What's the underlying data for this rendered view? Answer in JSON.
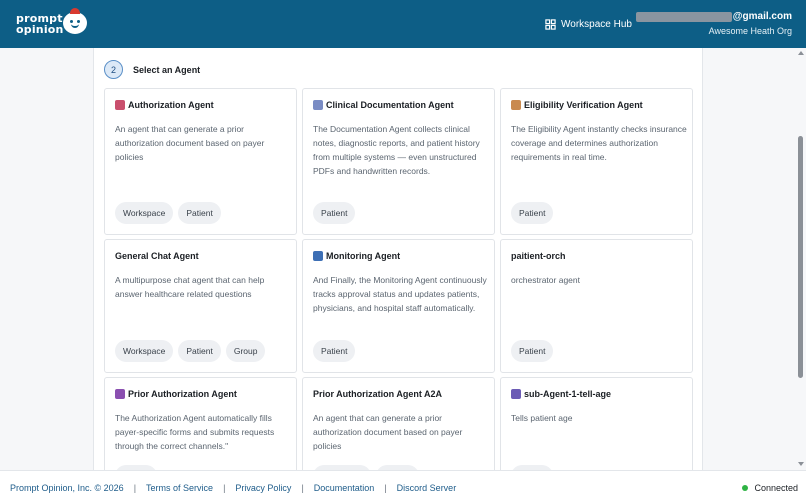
{
  "header": {
    "logo_text": "prompt\nopinion",
    "hub_label": "Workspace Hub",
    "email_suffix": "@gmail.com",
    "org": "Awesome Heath Org"
  },
  "step": {
    "number": "2",
    "title": "Select an Agent"
  },
  "agents": [
    {
      "name": "Authorization Agent",
      "icon": "hospital-emoji",
      "icon_color": "#c94f6d",
      "description": "An agent that can generate a prior authorization document based on payer policies",
      "tags": [
        "Workspace",
        "Patient"
      ]
    },
    {
      "name": "Clinical Documentation Agent",
      "icon": "microscope-emoji",
      "icon_color": "#7a8cc4",
      "description": "The Documentation Agent collects clinical notes, diagnostic reports, and patient history from multiple systems — even unstructured PDFs and handwritten records.",
      "tags": [
        "Patient"
      ]
    },
    {
      "name": "Eligibility Verification Agent",
      "icon": "clipboard-emoji",
      "icon_color": "#c98a4f",
      "description": "The Eligibility Agent instantly checks insurance coverage and determines authorization requirements in real time.",
      "tags": [
        "Patient"
      ]
    },
    {
      "name": "General Chat Agent",
      "icon": "",
      "icon_color": "",
      "description": "A multipurpose chat agent that can help answer healthcare related questions",
      "tags": [
        "Workspace",
        "Patient",
        "Group"
      ]
    },
    {
      "name": "Monitoring Agent",
      "icon": "stethoscope-emoji",
      "icon_color": "#3d6fb5",
      "description": "And Finally, the Monitoring Agent continuously tracks approval status and updates patients, physicians, and hospital staff automatically.",
      "tags": [
        "Patient"
      ]
    },
    {
      "name": "paitient-orch",
      "icon": "",
      "icon_color": "",
      "description": "orchestrator agent",
      "tags": [
        "Patient"
      ]
    },
    {
      "name": "Prior Authorization Agent",
      "icon": "document-emoji",
      "icon_color": "#8a4fb0",
      "description": "The Authorization Agent automatically fills payer-specific forms and submits requests through the correct channels.\"",
      "tags": [
        "Patient"
      ]
    },
    {
      "name": "Prior Authorization Agent A2A",
      "icon": "",
      "icon_color": "",
      "description": "An agent that can generate a prior authorization document based on payer policies",
      "tags": [
        "Workspace",
        "Patient"
      ]
    },
    {
      "name": "sub-Agent-1-tell-age",
      "icon": "robot-emoji",
      "icon_color": "#6b5bb5",
      "description": "Tells patient age",
      "tags": [
        "Patient"
      ]
    }
  ],
  "footer": {
    "copyright": "Prompt Opinion, Inc. © 2026",
    "links": [
      "Terms of Service",
      "Privacy Policy",
      "Documentation",
      "Discord Server"
    ],
    "status": "Connected",
    "status_color": "#2fb344"
  },
  "colors": {
    "header_bg": "#0d5e86",
    "accent": "#1e5c8a"
  }
}
